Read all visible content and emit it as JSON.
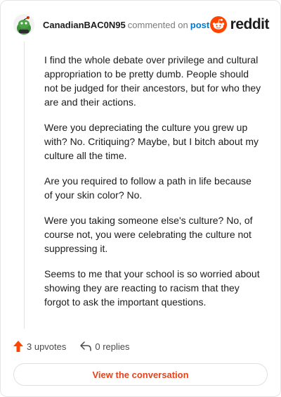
{
  "comment": {
    "username": "CanadianBAC0N95",
    "action_text": "commented on",
    "post_link": "post",
    "brand": "reddit",
    "paragraphs": [
      "I find the whole debate over privilege and cultural appropriation to be pretty dumb. People should not be judged for their ancestors, but for who they are and their actions.",
      "Were you depreciating the culture you grew up with? No. Critiquing? Maybe, but I bitch about my culture all the time.",
      "Are you required to follow a path in life because of your skin color? No.",
      "Were you taking someone else's culture? No, of course not, you were celebrating the culture not suppressing it.",
      "Seems to me that your school is so worried about showing they are reacting to racism that they forgot to ask the important questions."
    ],
    "upvotes_label": "3 upvotes",
    "replies_label": "0 replies",
    "view_button_label": "View the conversation"
  },
  "colors": {
    "accent": "#ff4500",
    "link": "#0079d3",
    "button_text": "#e2431d",
    "avatar_green": "#3d8f3a"
  },
  "icons": {
    "brand": "reddit-snoo-icon",
    "upvote": "upvote-arrow-icon",
    "reply": "reply-arrow-icon",
    "avatar": "snoo-avatar-icon"
  }
}
